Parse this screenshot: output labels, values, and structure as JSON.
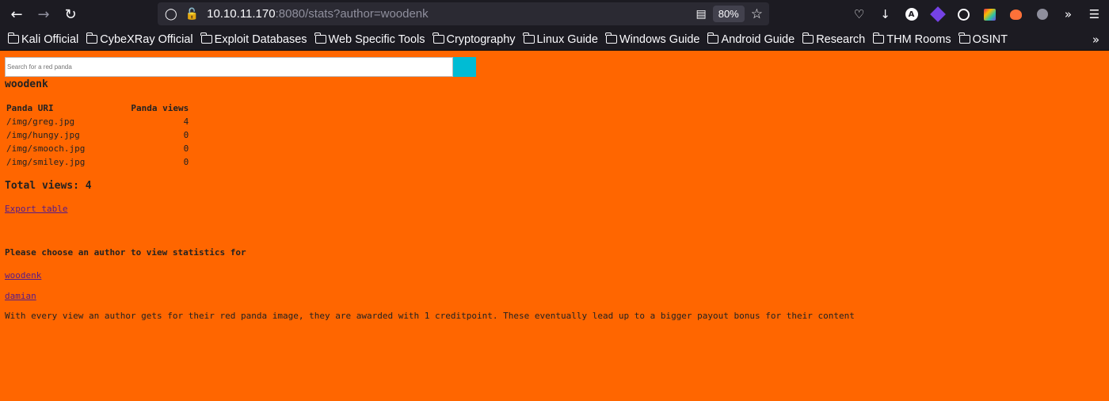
{
  "browser": {
    "url_host": "10.10.11.170",
    "url_rest": ":8080/stats?author=woodenk",
    "zoom": "80%",
    "icons": [
      "back-icon",
      "forward-icon",
      "reload-icon",
      "shield-icon",
      "lock-icon",
      "reader-icon",
      "star-icon",
      "pocket-icon",
      "download-icon",
      "menu-icon"
    ]
  },
  "bookmarks": [
    {
      "label": "Kali Official"
    },
    {
      "label": "CybeXRay Official"
    },
    {
      "label": "Exploit Databases"
    },
    {
      "label": "Web Specific Tools"
    },
    {
      "label": "Cryptography"
    },
    {
      "label": "Linux Guide"
    },
    {
      "label": "Windows Guide"
    },
    {
      "label": "Android Guide"
    },
    {
      "label": "Research"
    },
    {
      "label": "THM Rooms"
    },
    {
      "label": "OSINT"
    }
  ],
  "page": {
    "background": "#ff6600",
    "search": {
      "placeholder": "Search for a red panda",
      "button_color": "#00bcd4"
    },
    "author": "woodenk",
    "table": {
      "headers": [
        "Panda URI",
        "Panda views"
      ],
      "rows": [
        {
          "uri": "/img/greg.jpg",
          "views": "4"
        },
        {
          "uri": "/img/hungy.jpg",
          "views": "0"
        },
        {
          "uri": "/img/smooch.jpg",
          "views": "0"
        },
        {
          "uri": "/img/smiley.jpg",
          "views": "0"
        }
      ]
    },
    "total_views": "Total views: 4",
    "export_link": "Export table",
    "choose_heading": "Please choose an author to view statistics for",
    "authors": [
      "woodenk",
      "damian"
    ],
    "info": "With every view an author gets for their red panda image, they are awarded with 1 creditpoint. These eventually lead up to a bigger payout bonus for their content"
  }
}
